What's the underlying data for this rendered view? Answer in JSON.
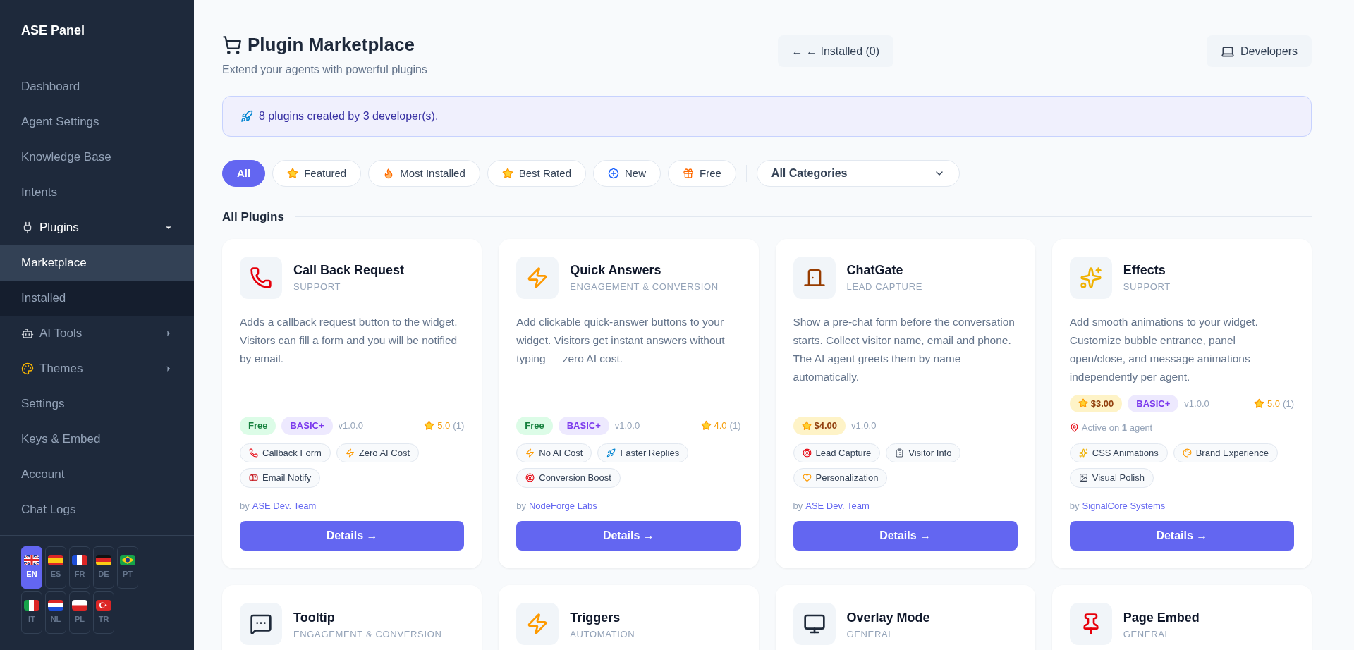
{
  "sidebar": {
    "title": "ASE Panel",
    "items": [
      {
        "label": "Dashboard",
        "selected": false
      },
      {
        "label": "Agent Settings",
        "selected": false
      },
      {
        "label": "Knowledge Base",
        "selected": false
      },
      {
        "label": "Intents",
        "selected": false
      },
      {
        "label": "Plugins",
        "selected": false,
        "expanded": true,
        "children": [
          {
            "label": "Marketplace",
            "selected": true
          },
          {
            "label": "Installed",
            "selected": false
          }
        ]
      },
      {
        "label": "AI Tools",
        "selected": false,
        "expanded": false
      },
      {
        "label": "Themes",
        "selected": false,
        "expanded": false
      },
      {
        "label": "Settings",
        "selected": false
      },
      {
        "label": "Keys & Embed",
        "selected": false
      },
      {
        "label": "Account",
        "selected": false
      },
      {
        "label": "Chat Logs",
        "selected": false
      }
    ],
    "languages": [
      {
        "code": "EN",
        "selected": true
      },
      {
        "code": "ES",
        "selected": false
      },
      {
        "code": "FR",
        "selected": false
      },
      {
        "code": "DE",
        "selected": false
      },
      {
        "code": "PT",
        "selected": false
      },
      {
        "code": "IT",
        "selected": false
      },
      {
        "code": "NL",
        "selected": false
      },
      {
        "code": "PL",
        "selected": false
      },
      {
        "code": "TR",
        "selected": false
      }
    ]
  },
  "header": {
    "title": "Plugin Marketplace",
    "subtitle": "Extend your agents with powerful plugins",
    "installed_button": "← ← Installed (0)",
    "developers_button": "Developers"
  },
  "banner": "8 plugins created by 3 developer(s).",
  "filters": [
    {
      "label": "All",
      "selected": true
    },
    {
      "label": "Featured",
      "selected": false
    },
    {
      "label": "Most Installed",
      "selected": false
    },
    {
      "label": "Best Rated",
      "selected": false
    },
    {
      "label": "New",
      "selected": false
    },
    {
      "label": "Free",
      "selected": false
    }
  ],
  "category_select": "All Categories",
  "section_title": "All Plugins",
  "plugins": [
    {
      "title": "Call Back Request",
      "category": "SUPPORT",
      "description": "Adds a callback request button to the widget. Visitors can fill a form and you will be notified by email.",
      "price": {
        "kind": "free",
        "label": "Free"
      },
      "tier": "BASIC+",
      "version": "v1.0.0",
      "rating": "5.0",
      "reviews": "(1)",
      "tags": [
        "Callback Form",
        "Zero AI Cost",
        "Email Notify"
      ],
      "by": "by",
      "author": "ASE Dev. Team",
      "button": "Details →"
    },
    {
      "title": "Quick Answers",
      "category": "ENGAGEMENT & CONVERSION",
      "description": "Add clickable quick-answer buttons to your widget. Visitors get instant answers without typing — zero AI cost.",
      "price": {
        "kind": "free",
        "label": "Free"
      },
      "tier": "BASIC+",
      "version": "v1.0.0",
      "rating": "4.0",
      "reviews": "(1)",
      "tags": [
        "No AI Cost",
        "Faster Replies",
        "Conversion Boost"
      ],
      "by": "by",
      "author": "NodeForge Labs",
      "button": "Details →"
    },
    {
      "title": "ChatGate",
      "category": "LEAD CAPTURE",
      "description": "Show a pre-chat form before the conversation starts. Collect visitor name, email and phone. The AI agent greets them by name automatically.",
      "price": {
        "kind": "paid",
        "label": "$4.00"
      },
      "version": "v1.0.0",
      "tags": [
        "Lead Capture",
        "Visitor Info",
        "Personalization"
      ],
      "by": "by",
      "author": "ASE Dev. Team",
      "button": "Details →"
    },
    {
      "title": "Effects",
      "category": "SUPPORT",
      "description": "Add smooth animations to your widget. Customize bubble entrance, panel open/close, and message animations independently per agent.",
      "price": {
        "kind": "paid",
        "label": "$3.00"
      },
      "tier": "BASIC+",
      "version": "v1.0.0",
      "rating": "5.0",
      "reviews": "(1)",
      "active": "Active on **1** agent",
      "tags": [
        "CSS Animations",
        "Brand Experience",
        "Visual Polish"
      ],
      "by": "by",
      "author": "SignalCore Systems",
      "button": "Details →"
    }
  ],
  "more_plugins": [
    {
      "title": "Tooltip",
      "category": "ENGAGEMENT & CONVERSION"
    },
    {
      "title": "Triggers",
      "category": "AUTOMATION"
    },
    {
      "title": "Overlay Mode",
      "category": "GENERAL"
    },
    {
      "title": "Page Embed",
      "category": "GENERAL"
    }
  ]
}
